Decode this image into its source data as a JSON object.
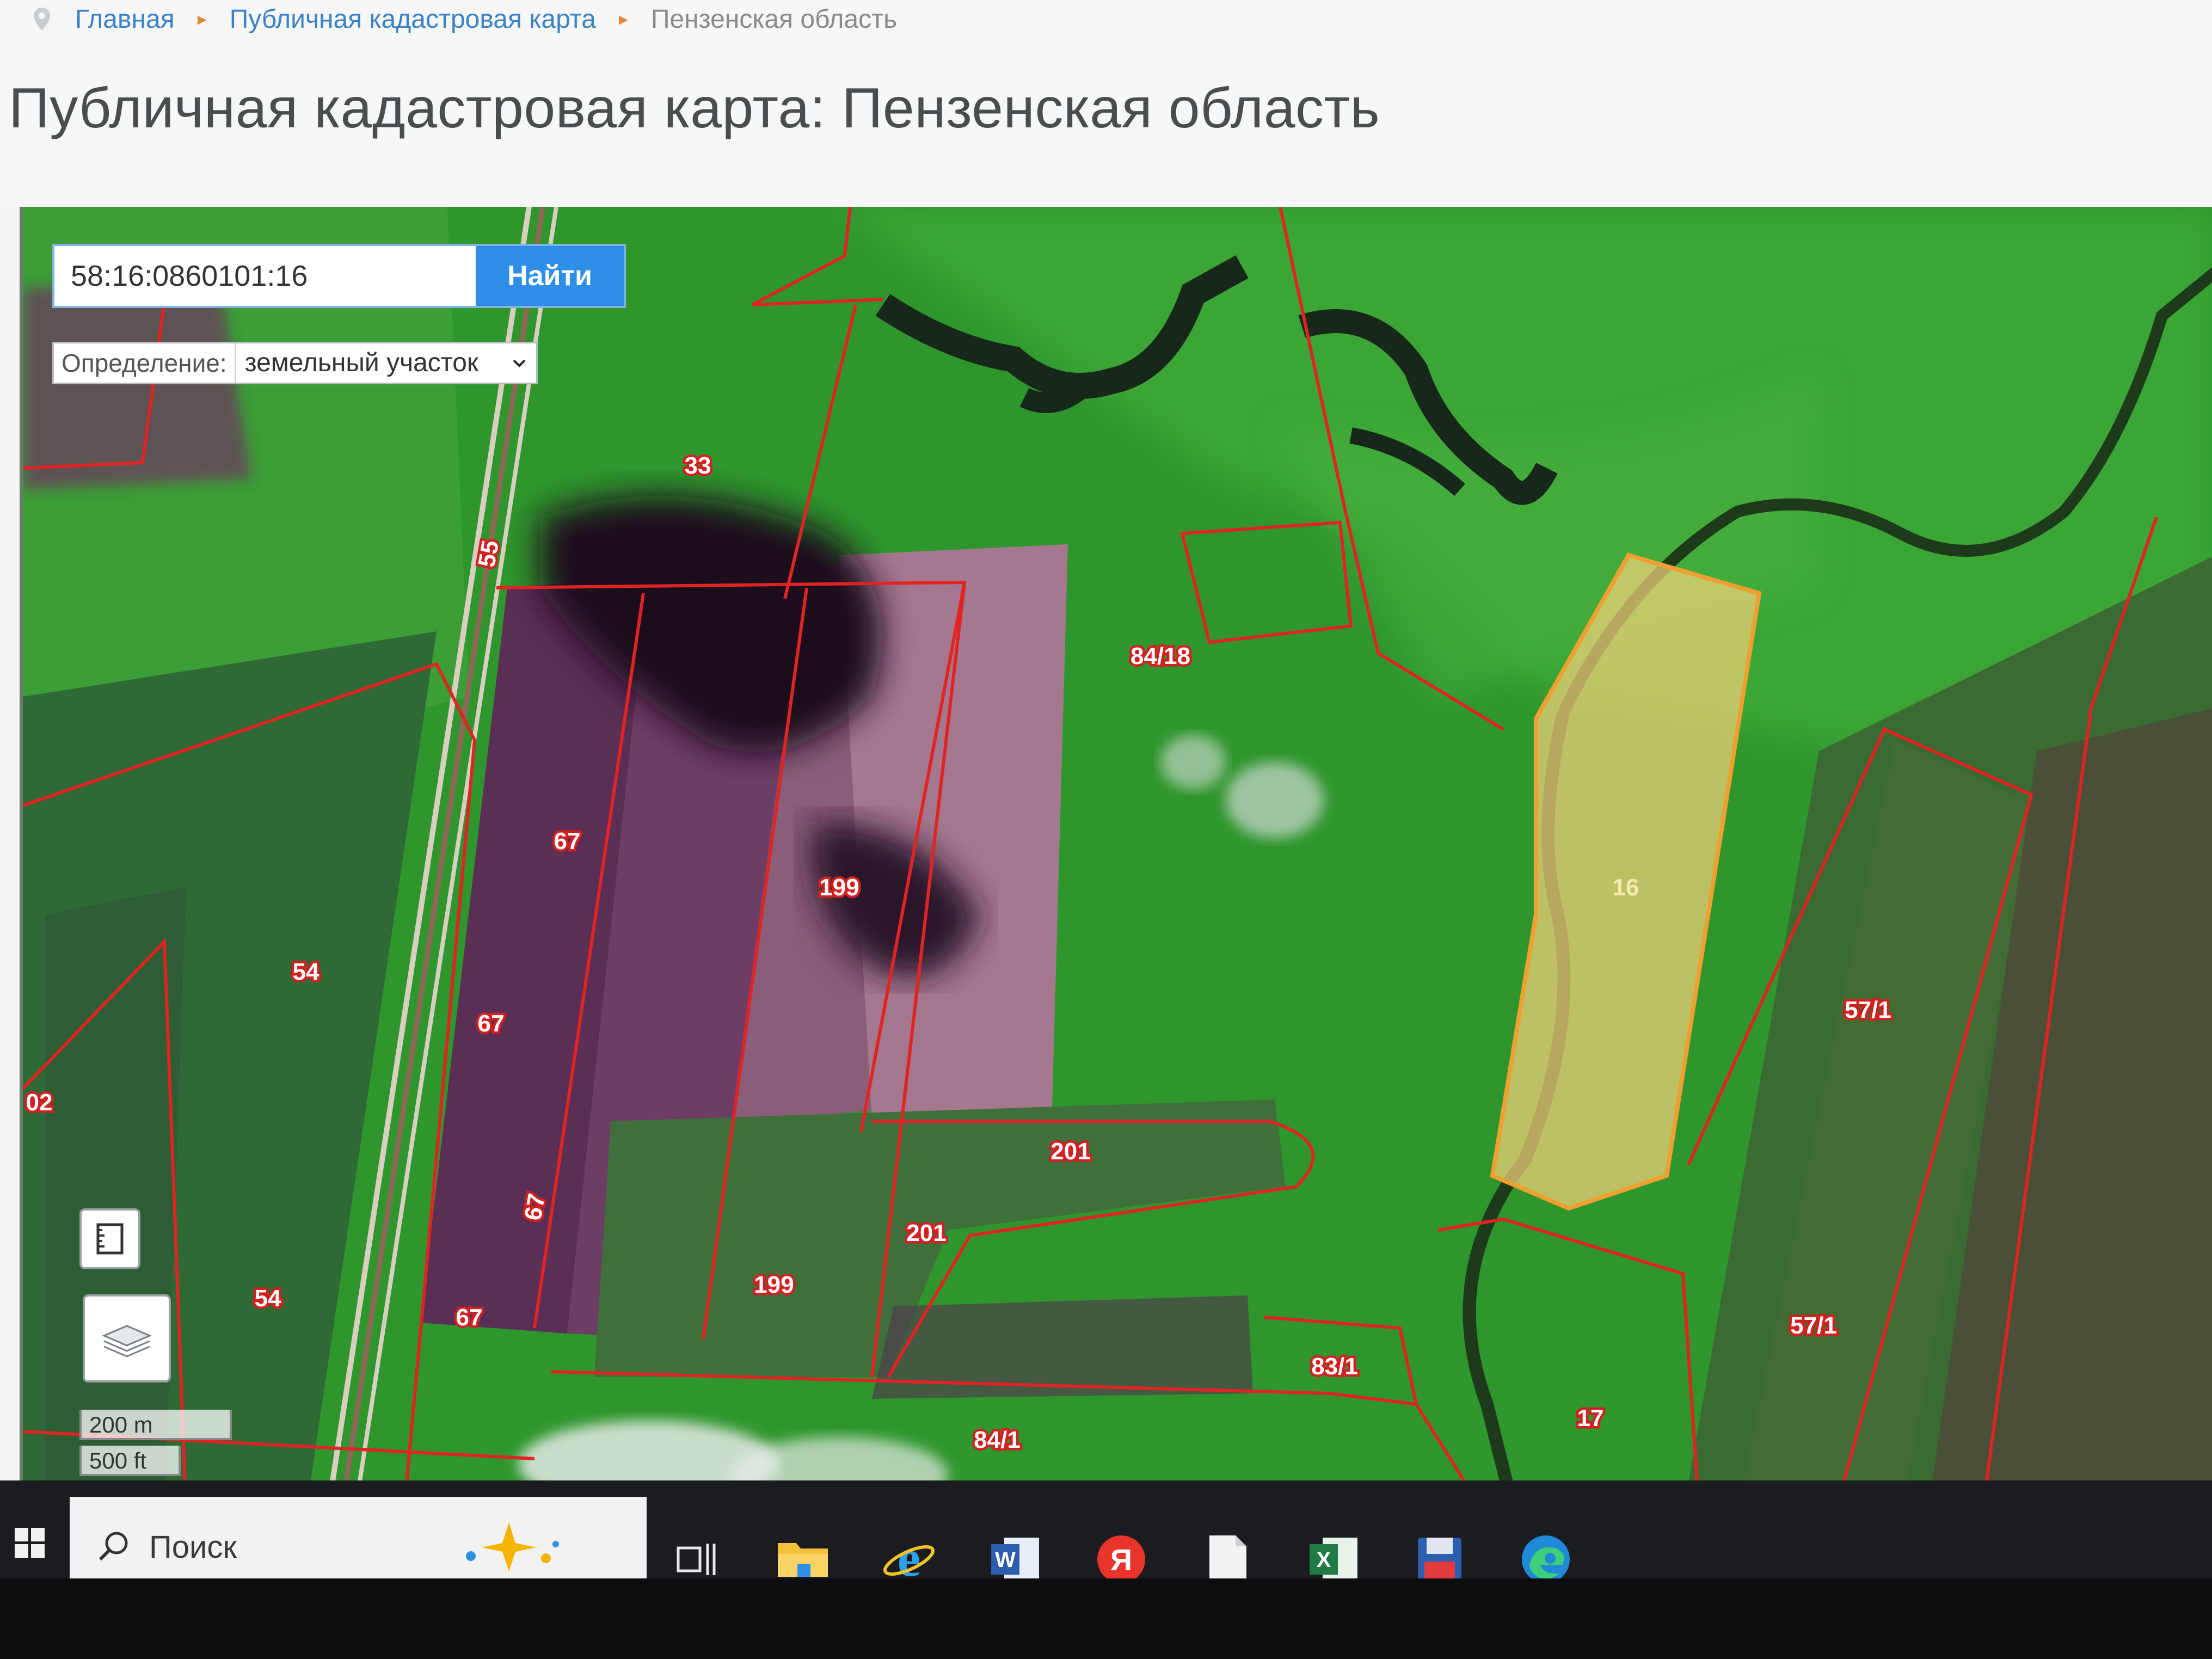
{
  "breadcrumb": {
    "home": "Главная",
    "section": "Публичная кадастровая карта",
    "current": "Пензенская область"
  },
  "page_title": "Публичная кадастровая карта: Пензенская область",
  "search": {
    "value": "58:16:0860101:16",
    "button_label": "Найти"
  },
  "definition": {
    "label": "Определение:",
    "selected": "земельный участок"
  },
  "parcel_labels": [
    "33",
    "55",
    "84/18",
    "67",
    "67",
    "67",
    "67",
    "199",
    "199",
    "54",
    "54",
    "201",
    "201",
    "16",
    "57/1",
    "57/1",
    "83/1",
    "84/1",
    "17",
    "02"
  ],
  "selected_parcel": "16",
  "scale": {
    "metric": "200 m",
    "imperial": "500 ft"
  },
  "taskbar": {
    "search_label": "Поиск",
    "apps": [
      "task-view",
      "file-explorer",
      "internet-explorer",
      "word",
      "yandex-browser",
      "notepad",
      "excel",
      "save-app",
      "edge"
    ]
  },
  "colors": {
    "boundary": "#e02424",
    "selected_fill": "#f2d27a",
    "selected_outline": "#f0a030",
    "accent": "#2f8ee6",
    "link": "#3a83c7"
  }
}
